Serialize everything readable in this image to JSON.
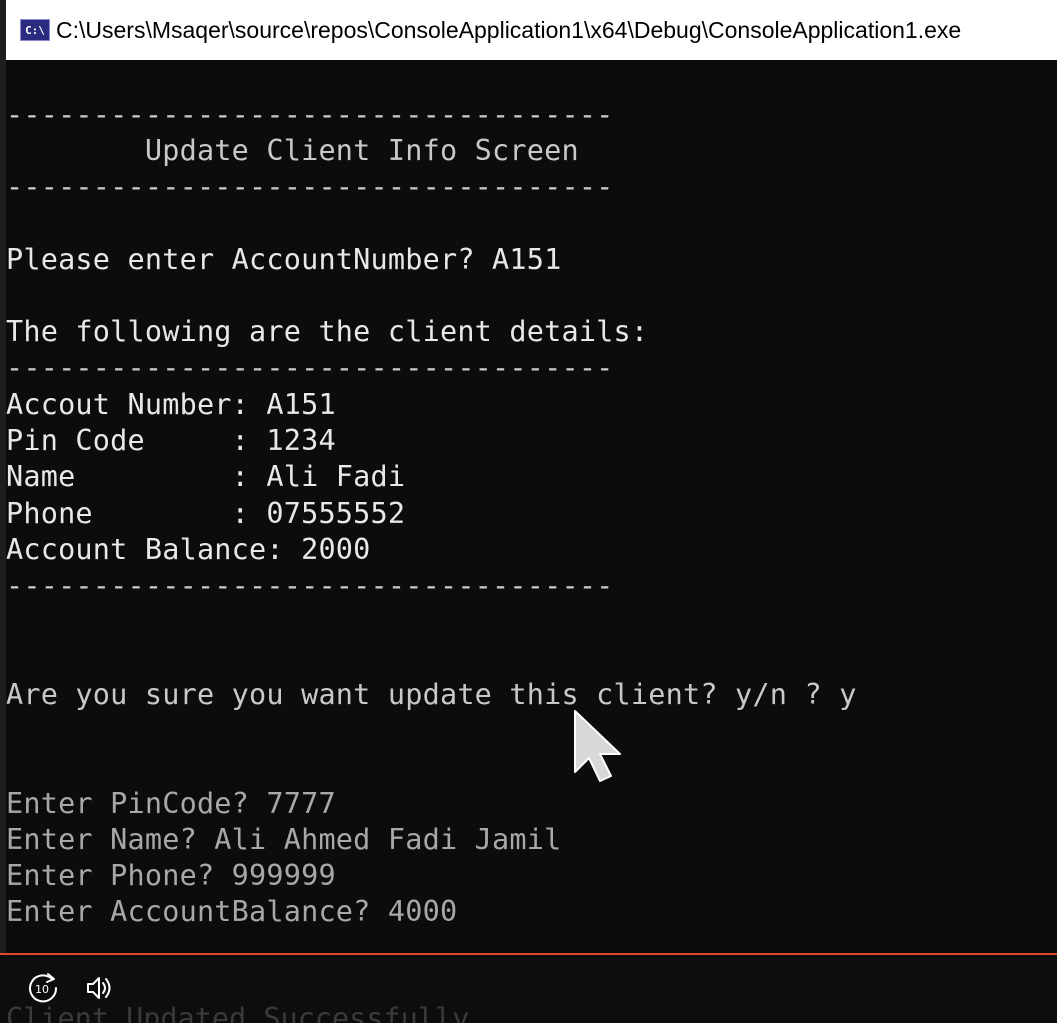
{
  "window": {
    "title": "C:\\Users\\Msaqer\\source\\repos\\ConsoleApplication1\\x64\\Debug\\ConsoleApplication1.exe",
    "icon_text": "C:\\"
  },
  "console": {
    "lines": [
      "-----------------------------------",
      "        Update Client Info Screen",
      "-----------------------------------",
      "",
      "Please enter AccountNumber? A151",
      "",
      "The following are the client details:",
      "-----------------------------------",
      "Accout Number: A151",
      "Pin Code     : 1234",
      "Name         : Ali Fadi",
      "Phone        : 07555552",
      "Account Balance: 2000",
      "-----------------------------------",
      "",
      "",
      "Are you sure you want update this client? y/n ? y",
      "",
      "",
      "Enter PinCode? 7777",
      "Enter Name? Ali Ahmed Fadi Jamil",
      "Enter Phone? 999999",
      "Enter AccountBalance? 4000"
    ]
  },
  "player": {
    "skip_label": "10",
    "ghost_text": "Client Updated Successfully"
  },
  "icons": {
    "skip": "skip-forward-10-icon",
    "volume": "volume-icon",
    "cursor": "mouse-pointer-icon"
  },
  "colors": {
    "console_bg": "#0c0c0c",
    "console_text": "#cccccc",
    "titlebar_bg": "#ffffff",
    "progress_line": "#e0482e"
  }
}
